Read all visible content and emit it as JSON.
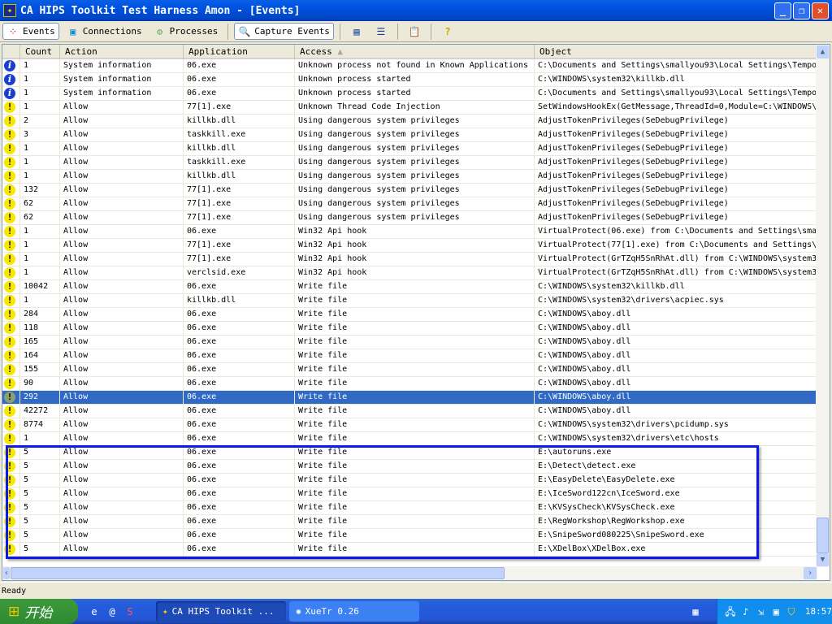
{
  "window": {
    "title": "CA HIPS Toolkit Test Harness Amon - [Events]"
  },
  "toolbar": {
    "events": "Events",
    "connections": "Connections",
    "processes": "Processes",
    "capture": "Capture Events"
  },
  "columns": [
    "",
    "Count",
    "Action",
    "Application",
    "Access",
    "Object"
  ],
  "sort_indicator": "▲",
  "rows": [
    [
      "info",
      "1",
      "System information",
      "06.exe",
      "Unknown process not found in Known Applications",
      "C:\\Documents and Settings\\smallyou93\\Local Settings\\Tempo"
    ],
    [
      "info",
      "1",
      "System information",
      "06.exe",
      "Unknown process started",
      "C:\\WINDOWS\\system32\\killkb.dll"
    ],
    [
      "info",
      "1",
      "System information",
      "06.exe",
      "Unknown process started",
      "C:\\Documents and Settings\\smallyou93\\Local Settings\\Tempo"
    ],
    [
      "warn",
      "1",
      "Allow",
      "77[1].exe",
      "Unknown Thread Code Injection",
      "SetWindowsHookEx(GetMessage,ThreadId=0,Module=C:\\WINDOWS\\"
    ],
    [
      "warn",
      "2",
      "Allow",
      "killkb.dll",
      "Using dangerous system privileges",
      "AdjustTokenPrivileges(SeDebugPrivilege)"
    ],
    [
      "warn",
      "3",
      "Allow",
      "taskkill.exe",
      "Using dangerous system privileges",
      "AdjustTokenPrivileges(SeDebugPrivilege)"
    ],
    [
      "warn",
      "1",
      "Allow",
      "killkb.dll",
      "Using dangerous system privileges",
      "AdjustTokenPrivileges(SeDebugPrivilege)"
    ],
    [
      "warn",
      "1",
      "Allow",
      "taskkill.exe",
      "Using dangerous system privileges",
      "AdjustTokenPrivileges(SeDebugPrivilege)"
    ],
    [
      "warn",
      "1",
      "Allow",
      "killkb.dll",
      "Using dangerous system privileges",
      "AdjustTokenPrivileges(SeDebugPrivilege)"
    ],
    [
      "warn",
      "132",
      "Allow",
      "77[1].exe",
      "Using dangerous system privileges",
      "AdjustTokenPrivileges(SeDebugPrivilege)"
    ],
    [
      "warn",
      "62",
      "Allow",
      "77[1].exe",
      "Using dangerous system privileges",
      "AdjustTokenPrivileges(SeDebugPrivilege)"
    ],
    [
      "warn",
      "62",
      "Allow",
      "77[1].exe",
      "Using dangerous system privileges",
      "AdjustTokenPrivileges(SeDebugPrivilege)"
    ],
    [
      "warn",
      "1",
      "Allow",
      "06.exe",
      "Win32 Api hook",
      "VirtualProtect(06.exe) from C:\\Documents and Settings\\smal"
    ],
    [
      "warn",
      "1",
      "Allow",
      "77[1].exe",
      "Win32 Api hook",
      "VirtualProtect(77[1].exe) from C:\\Documents and Settings\\"
    ],
    [
      "warn",
      "1",
      "Allow",
      "77[1].exe",
      "Win32 Api hook",
      "VirtualProtect(GrTZqH5SnRhAt.dll) from C:\\WINDOWS\\system3"
    ],
    [
      "warn",
      "1",
      "Allow",
      "verclsid.exe",
      "Win32 Api hook",
      "VirtualProtect(GrTZqH5SnRhAt.dll) from C:\\WINDOWS\\system3"
    ],
    [
      "warn",
      "10042",
      "Allow",
      "06.exe",
      "Write file",
      "C:\\WINDOWS\\system32\\killkb.dll"
    ],
    [
      "warn",
      "1",
      "Allow",
      "killkb.dll",
      "Write file",
      "C:\\WINDOWS\\system32\\drivers\\acpiec.sys"
    ],
    [
      "warn",
      "284",
      "Allow",
      "06.exe",
      "Write file",
      "C:\\WINDOWS\\aboy.dll"
    ],
    [
      "warn",
      "118",
      "Allow",
      "06.exe",
      "Write file",
      "C:\\WINDOWS\\aboy.dll"
    ],
    [
      "warn",
      "165",
      "Allow",
      "06.exe",
      "Write file",
      "C:\\WINDOWS\\aboy.dll"
    ],
    [
      "warn",
      "164",
      "Allow",
      "06.exe",
      "Write file",
      "C:\\WINDOWS\\aboy.dll"
    ],
    [
      "warn",
      "155",
      "Allow",
      "06.exe",
      "Write file",
      "C:\\WINDOWS\\aboy.dll"
    ],
    [
      "warn",
      "90",
      "Allow",
      "06.exe",
      "Write file",
      "C:\\WINDOWS\\aboy.dll"
    ],
    [
      "selw",
      "292",
      "Allow",
      "06.exe",
      "Write file",
      "C:\\WINDOWS\\aboy.dll"
    ],
    [
      "warn",
      "42272",
      "Allow",
      "06.exe",
      "Write file",
      "C:\\WINDOWS\\aboy.dll"
    ],
    [
      "warn",
      "8774",
      "Allow",
      "06.exe",
      "Write file",
      "C:\\WINDOWS\\system32\\drivers\\pcidump.sys"
    ],
    [
      "warn",
      "1",
      "Allow",
      "06.exe",
      "Write file",
      "C:\\WINDOWS\\system32\\drivers\\etc\\hosts"
    ],
    [
      "warn",
      "5",
      "Allow",
      "06.exe",
      "Write file",
      "E:\\autoruns.exe"
    ],
    [
      "warn",
      "5",
      "Allow",
      "06.exe",
      "Write file",
      "E:\\Detect\\detect.exe"
    ],
    [
      "warn",
      "5",
      "Allow",
      "06.exe",
      "Write file",
      "E:\\EasyDelete\\EasyDelete.exe"
    ],
    [
      "warn",
      "5",
      "Allow",
      "06.exe",
      "Write file",
      "E:\\IceSword122cn\\IceSword.exe"
    ],
    [
      "warn",
      "5",
      "Allow",
      "06.exe",
      "Write file",
      "E:\\KVSysCheck\\KVSysCheck.exe"
    ],
    [
      "warn",
      "5",
      "Allow",
      "06.exe",
      "Write file",
      "E:\\RegWorkshop\\RegWorkshop.exe"
    ],
    [
      "warn",
      "5",
      "Allow",
      "06.exe",
      "Write file",
      "E:\\SnipeSword080225\\SnipeSword.exe"
    ],
    [
      "warn",
      "5",
      "Allow",
      "06.exe",
      "Write file",
      "E:\\XDelBox\\XDelBox.exe"
    ]
  ],
  "selected_row": 24,
  "status": "Ready",
  "taskbar": {
    "start": "开始",
    "tasks": [
      "CA HIPS Toolkit ...",
      "XueTr 0.26"
    ],
    "clock": "18:57"
  },
  "colors": {
    "selection": "#316ac5",
    "annotation": "#0b18f0"
  }
}
